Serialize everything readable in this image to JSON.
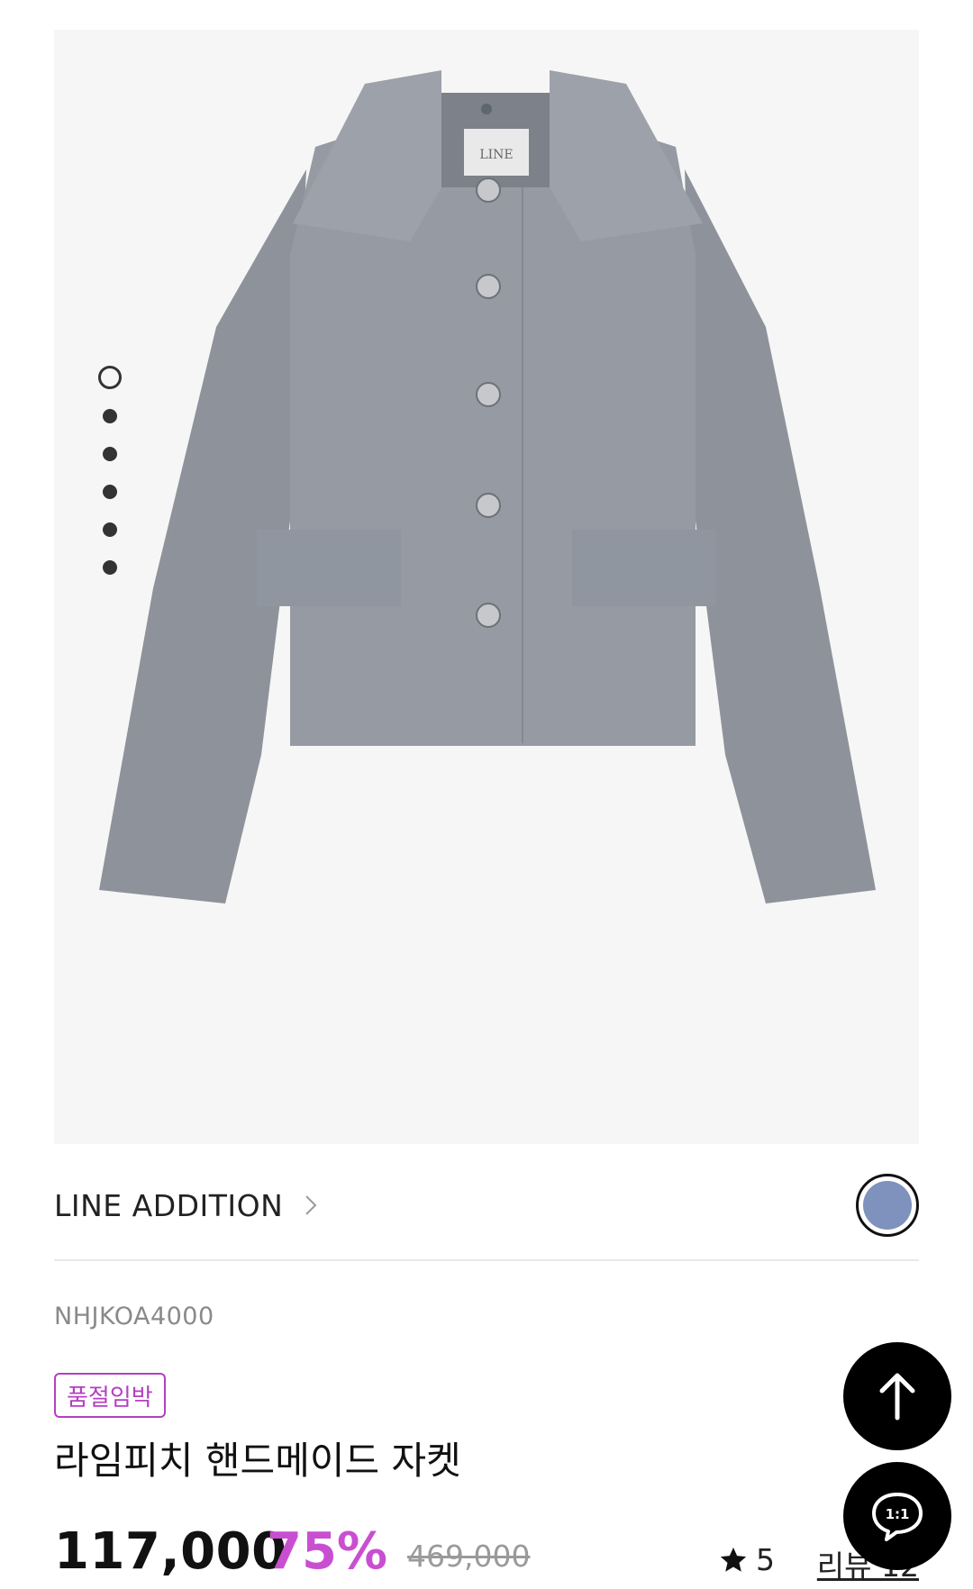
{
  "gallery": {
    "image_alt": "grey wool cropped jacket",
    "label_on_garment": "LINE",
    "slide_count": 6,
    "active_slide": 1
  },
  "brand": {
    "name": "LINE ADDITION"
  },
  "color_swatch": {
    "color": "#7e92bd"
  },
  "product": {
    "sku": "NHJKOA4000",
    "badge": "품절임박",
    "name": "라임피치 핸드메이드 자켓"
  },
  "pricing": {
    "price": "117,000",
    "discount": "75%",
    "original_price": "469,000"
  },
  "rating": {
    "score": "5",
    "reviews_label": "리뷰 12"
  },
  "floating": {
    "chat_label": "1:1"
  },
  "colors": {
    "accent": "#c94fd1",
    "badge": "#b43fc2",
    "fab": "#000000"
  }
}
